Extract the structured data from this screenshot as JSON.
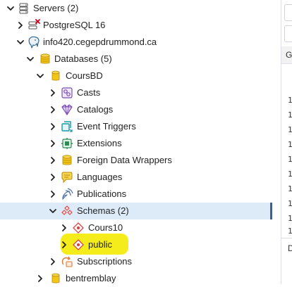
{
  "tree": {
    "servers": "Servers (2)",
    "postgres16": "PostgreSQL 16",
    "info420": "info420.cegepdrummond.ca",
    "databases": "Databases (5)",
    "coursbd": "CoursBD",
    "casts": "Casts",
    "catalogs": "Catalogs",
    "event_triggers": "Event Triggers",
    "extensions": "Extensions",
    "fdw": "Foreign Data Wrappers",
    "languages": "Languages",
    "publications": "Publications",
    "schemas": "Schemas (2)",
    "cours10": "Cours10",
    "public": "public",
    "subscriptions": "Subscriptions",
    "bentremblay": "bentremblay"
  },
  "right_panel": {
    "tab_label": "G",
    "line_numbers": [
      "1",
      "1",
      "1",
      "1",
      "1",
      "1",
      "1",
      "1",
      "1",
      "1"
    ],
    "bottom_label": "D"
  },
  "colors": {
    "selected_row": "#ddeaf8",
    "selection_bar": "#326690",
    "highlight": "#f5ec1c",
    "chevron": "#222222"
  },
  "icons": {
    "servers": "server-group-icon",
    "postgres16": "server-disconnected-icon",
    "info420": "postgres-elephant-icon",
    "databases": "databases-icon",
    "coursbd": "database-icon",
    "casts": "cast-icon",
    "catalogs": "catalog-icon",
    "event_triggers": "event-trigger-icon",
    "extensions": "extension-icon",
    "fdw": "foreign-data-wrapper-icon",
    "languages": "language-icon",
    "publications": "publication-icon",
    "schemas": "schemas-icon",
    "cours10": "schema-icon",
    "public": "schema-icon",
    "subscriptions": "subscription-icon",
    "bentremblay": "database-icon"
  }
}
